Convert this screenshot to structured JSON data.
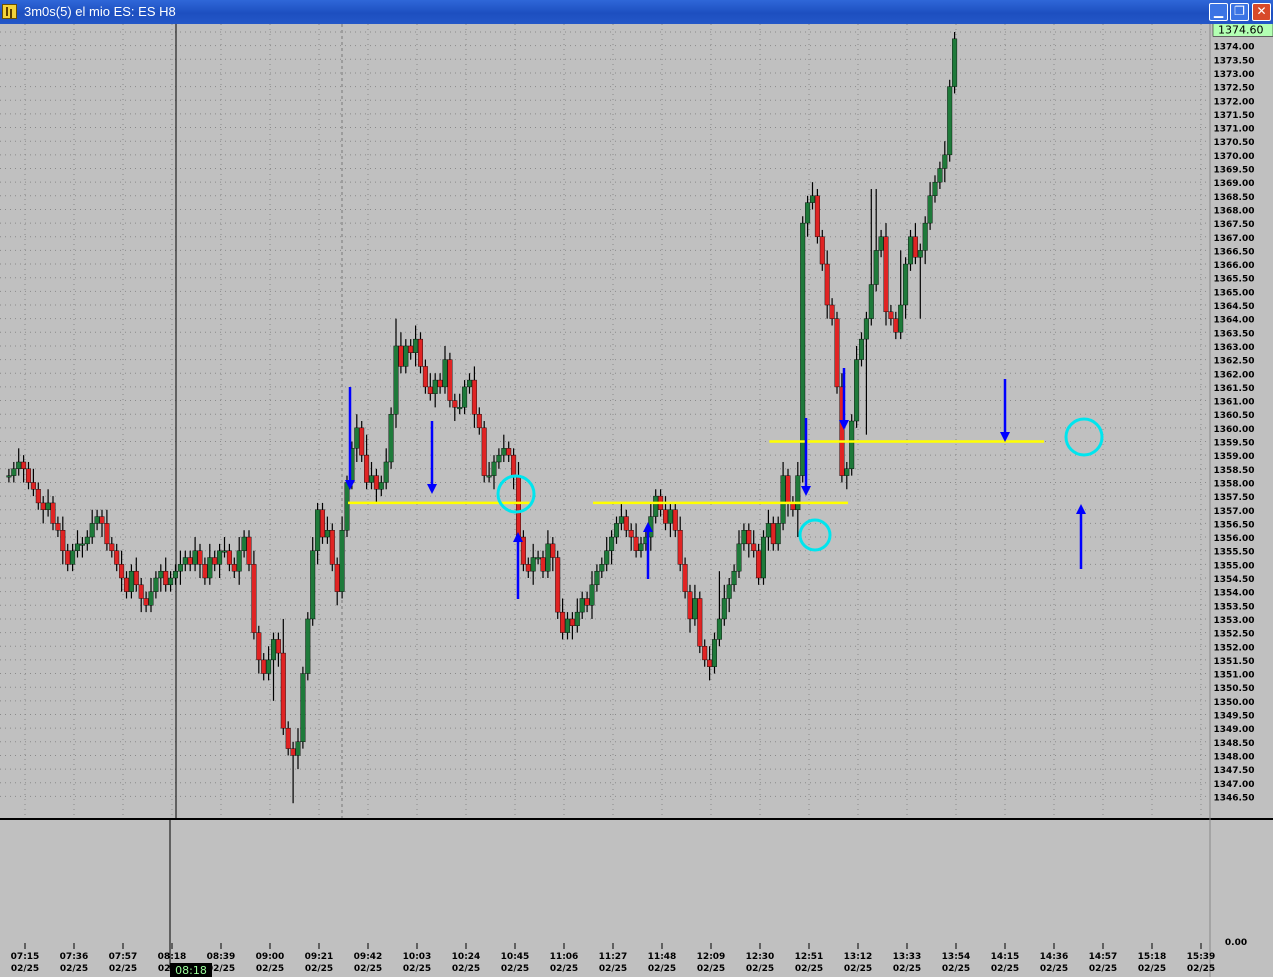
{
  "window": {
    "title": "3m0s(5) el mio ES: ES H8",
    "buttons": {
      "minimize": "▁",
      "restore": "❐",
      "close": "✕"
    }
  },
  "colors": {
    "background": "#c0c0c0",
    "bull": "#1e7a3a",
    "bear": "#e02424",
    "wick": "#000000",
    "level_line": "#ffff00",
    "arrow": "#0000ff",
    "circle": "#00e5ee",
    "price_box": "#b3ffb3"
  },
  "chart_data": {
    "type": "candlestick",
    "instrument": "ES H8",
    "y_ticks": [
      "1374.00",
      "1373.50",
      "1373.00",
      "1372.50",
      "1372.00",
      "1371.50",
      "1371.00",
      "1370.50",
      "1370.00",
      "1369.50",
      "1369.00",
      "1368.50",
      "1368.00",
      "1367.50",
      "1367.00",
      "1366.50",
      "1366.00",
      "1365.50",
      "1365.00",
      "1364.50",
      "1364.00",
      "1363.50",
      "1363.00",
      "1362.50",
      "1362.00",
      "1361.50",
      "1361.00",
      "1360.50",
      "1360.00",
      "1359.50",
      "1359.00",
      "1358.50",
      "1358.00",
      "1357.50",
      "1357.00",
      "1356.50",
      "1356.00",
      "1355.50",
      "1355.00",
      "1354.50",
      "1354.00",
      "1353.50",
      "1353.00",
      "1352.50",
      "1352.00",
      "1351.50",
      "1351.00",
      "1350.50",
      "1350.00",
      "1349.50",
      "1349.00",
      "1348.50",
      "1348.00",
      "1347.50",
      "1347.00",
      "1346.50"
    ],
    "last_price": "1374.60",
    "lower_pane_tick": "0.00",
    "x_ticks": [
      {
        "time": "07:15",
        "date": "02/25"
      },
      {
        "time": "07:36",
        "date": "02/25"
      },
      {
        "time": "07:57",
        "date": "02/25"
      },
      {
        "time": "08:18",
        "date": "02/25"
      },
      {
        "time": "08:39",
        "date": "02/25"
      },
      {
        "time": "09:00",
        "date": "02/25"
      },
      {
        "time": "09:21",
        "date": "02/25"
      },
      {
        "time": "09:42",
        "date": "02/25"
      },
      {
        "time": "10:03",
        "date": "02/25"
      },
      {
        "time": "10:24",
        "date": "02/25"
      },
      {
        "time": "10:45",
        "date": "02/25"
      },
      {
        "time": "11:06",
        "date": "02/25"
      },
      {
        "time": "11:27",
        "date": "02/25"
      },
      {
        "time": "11:48",
        "date": "02/25"
      },
      {
        "time": "12:09",
        "date": "02/25"
      },
      {
        "time": "12:30",
        "date": "02/25"
      },
      {
        "time": "12:51",
        "date": "02/25"
      },
      {
        "time": "13:12",
        "date": "02/25"
      },
      {
        "time": "13:33",
        "date": "02/25"
      },
      {
        "time": "13:54",
        "date": "02/25"
      },
      {
        "time": "14:15",
        "date": "02/25"
      },
      {
        "time": "14:36",
        "date": "02/25"
      },
      {
        "time": "14:57",
        "date": "02/25"
      },
      {
        "time": "15:18",
        "date": "02/25"
      },
      {
        "time": "15:39",
        "date": "02/25"
      }
    ],
    "cursor_time": "08:18",
    "closes": [
      1358.25,
      1358.25,
      1358.5,
      1358.75,
      1358.5,
      1358,
      1357.75,
      1357.25,
      1357,
      1357.25,
      1356.5,
      1356.25,
      1355.5,
      1355,
      1355.5,
      1355.75,
      1355.75,
      1356,
      1356.5,
      1356.75,
      1356.5,
      1355.75,
      1355.5,
      1355,
      1354.5,
      1354,
      1354.75,
      1354.25,
      1353.75,
      1353.5,
      1354,
      1354.5,
      1354.75,
      1354.25,
      1354.5,
      1354.75,
      1355,
      1355.25,
      1355,
      1355.5,
      1355,
      1354.5,
      1355.25,
      1355,
      1355.5,
      1355.5,
      1355,
      1354.75,
      1355.5,
      1356,
      1355,
      1352.5,
      1351.5,
      1351,
      1351.5,
      1352.25,
      1351.75,
      1349,
      1348.25,
      1348,
      1348.5,
      1351,
      1353,
      1355.5,
      1357,
      1356,
      1356.25,
      1355,
      1354,
      1356.25,
      1358,
      1359.25,
      1360,
      1359,
      1358,
      1358.25,
      1357.75,
      1358,
      1358.75,
      1360.5,
      1363,
      1362.25,
      1363,
      1362.75,
      1363.25,
      1362.25,
      1361.5,
      1361.25,
      1361.75,
      1361.5,
      1362.5,
      1361,
      1360.75,
      1360.75,
      1361.5,
      1361.75,
      1360.5,
      1360,
      1358.25,
      1358.25,
      1358.75,
      1359,
      1359.25,
      1359,
      1358.25,
      1356,
      1355,
      1354.75,
      1355.25,
      1355.25,
      1354.75,
      1355.75,
      1355.25,
      1353.25,
      1352.5,
      1353,
      1352.75,
      1353.25,
      1353.75,
      1353.5,
      1354.25,
      1354.75,
      1355,
      1355.5,
      1356,
      1356.5,
      1356.75,
      1356.25,
      1356,
      1355.5,
      1355.75,
      1356,
      1356.75,
      1357.5,
      1357,
      1356.5,
      1357,
      1356.25,
      1355,
      1354,
      1353,
      1353.75,
      1352,
      1351.5,
      1351.25,
      1352.25,
      1353,
      1353.75,
      1354.25,
      1354.75,
      1355.75,
      1356.25,
      1355.75,
      1355.5,
      1354.5,
      1356,
      1356.5,
      1355.75,
      1356.5,
      1358.25,
      1357.25,
      1357,
      1358.25,
      1367.5,
      1368.25,
      1368.5,
      1367,
      1366,
      1364.5,
      1364,
      1361.5,
      1358.25,
      1358.5,
      1360.25,
      1362.5,
      1363.25,
      1364,
      1365.25,
      1366.5,
      1367,
      1364.25,
      1364,
      1363.5,
      1364.5,
      1366,
      1367,
      1366.25,
      1366.5,
      1367.5,
      1368.5,
      1369,
      1369.5,
      1370,
      1372.5,
      1374.25
    ]
  },
  "annotations": {
    "level_lines": [
      {
        "price": 1357.25,
        "from_bar": 60,
        "to_bar": 95
      },
      {
        "price": 1357.25,
        "from_bar": 110,
        "to_bar": 160
      },
      {
        "price": 1359.5,
        "from_bar": 146,
        "to_bar": 200
      }
    ]
  }
}
